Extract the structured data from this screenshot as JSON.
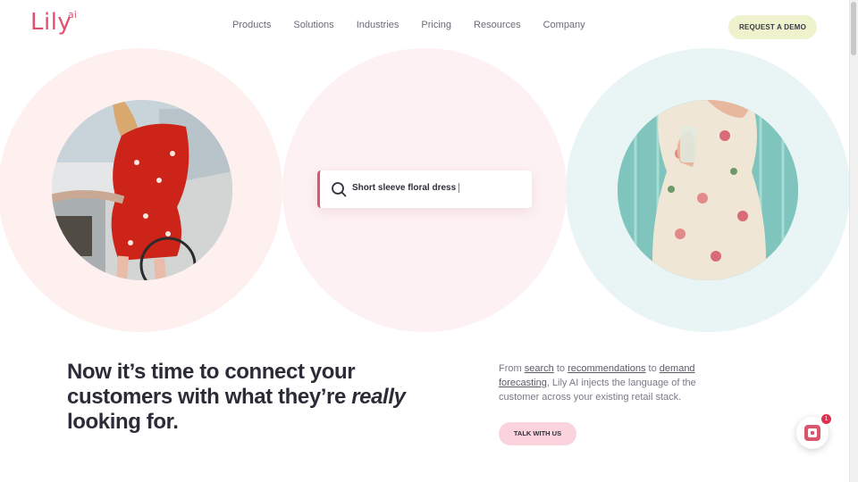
{
  "header": {
    "logo_text": "Lily",
    "logo_suffix": "ai",
    "nav": [
      "Products",
      "Solutions",
      "Industries",
      "Pricing",
      "Resources",
      "Company"
    ],
    "cta_label": "REQUEST A DEMO"
  },
  "hero": {
    "search_query": "Short sleeve floral dress",
    "icons": {
      "search": "search-icon"
    }
  },
  "intro": {
    "headline_part1": "Now it’s time to connect your customers with what they’re ",
    "headline_emphasis": "really",
    "headline_part2": " looking for.",
    "paragraph": {
      "from": "From ",
      "link_search": "search",
      "to1": " to ",
      "link_recommendations": "recommendations",
      "to2": " to ",
      "link_demand": "demand forecasting",
      "rest": ", Lily AI injects the language of the customer across your existing retail stack."
    },
    "talk_label": "TALK WITH US"
  },
  "chat": {
    "badge_count": "1"
  },
  "colors": {
    "brand": "#e0506e",
    "cta_bg": "#eef3cd",
    "talk_bg": "#fbd3dd"
  }
}
